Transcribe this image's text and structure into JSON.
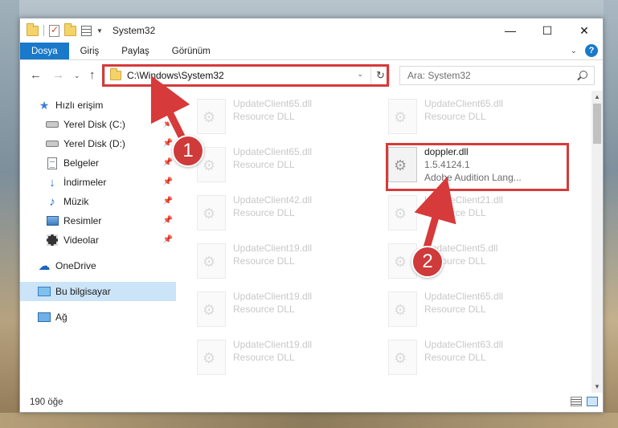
{
  "window": {
    "title": "System32",
    "controls": {
      "minimize": "—",
      "maximize": "☐",
      "close": "✕"
    }
  },
  "ribbon": {
    "tabs": [
      "Dosya",
      "Giriş",
      "Paylaş",
      "Görünüm"
    ],
    "active_tab": "Dosya",
    "help": "?"
  },
  "address": {
    "path": "C:\\Windows\\System32",
    "search_placeholder": "Ara: System32"
  },
  "sidebar": {
    "items": [
      {
        "label": "Hızlı erişim",
        "icon": "star-icon"
      },
      {
        "label": "Yerel Disk (C:)",
        "icon": "drive-icon",
        "pinned": true
      },
      {
        "label": "Yerel Disk (D:)",
        "icon": "drive-icon",
        "pinned": true
      },
      {
        "label": "Belgeler",
        "icon": "documents-icon",
        "pinned": true
      },
      {
        "label": "İndirmeler",
        "icon": "download-icon",
        "pinned": true
      },
      {
        "label": "Müzik",
        "icon": "music-icon",
        "pinned": true
      },
      {
        "label": "Resimler",
        "icon": "pictures-icon",
        "pinned": true
      },
      {
        "label": "Videolar",
        "icon": "videos-icon",
        "pinned": true
      },
      {
        "label": "OneDrive",
        "icon": "onedrive-icon"
      },
      {
        "label": "Bu bilgisayar",
        "icon": "this-pc-icon",
        "selected": true
      },
      {
        "label": "Ağ",
        "icon": "network-icon"
      }
    ]
  },
  "files": {
    "left": [
      {
        "name": "UpdateClient65.dll",
        "sub": "Resource DLL"
      },
      {
        "name": "UpdateClient65.dll",
        "sub": "Resource DLL"
      },
      {
        "name": "UpdateClient42.dll",
        "sub": "Resource DLL"
      },
      {
        "name": "UpdateClient19.dll",
        "sub": "Resource DLL"
      },
      {
        "name": "UpdateClient19.dll",
        "sub": "Resource DLL"
      },
      {
        "name": "UpdateClient19.dll",
        "sub": "Resource DLL"
      }
    ],
    "right": [
      {
        "name": "UpdateClient65.dll",
        "sub": "Resource DLL"
      },
      {
        "name": "doppler.dll",
        "sub": "1.5.4124.1",
        "sub2": "Adobe Audition Lang..."
      },
      {
        "name": "UpdateClient21.dll",
        "sub": "Resource DLL"
      },
      {
        "name": "UpdateClient5.dll",
        "sub": "Resource DLL"
      },
      {
        "name": "UpdateClient65.dll",
        "sub": "Resource DLL"
      },
      {
        "name": "UpdateClient63.dll",
        "sub": "Resource DLL"
      }
    ]
  },
  "status": {
    "count": "190 öğe"
  },
  "annotations": {
    "badge1": "1",
    "badge2": "2",
    "color": "#d63a3a"
  }
}
